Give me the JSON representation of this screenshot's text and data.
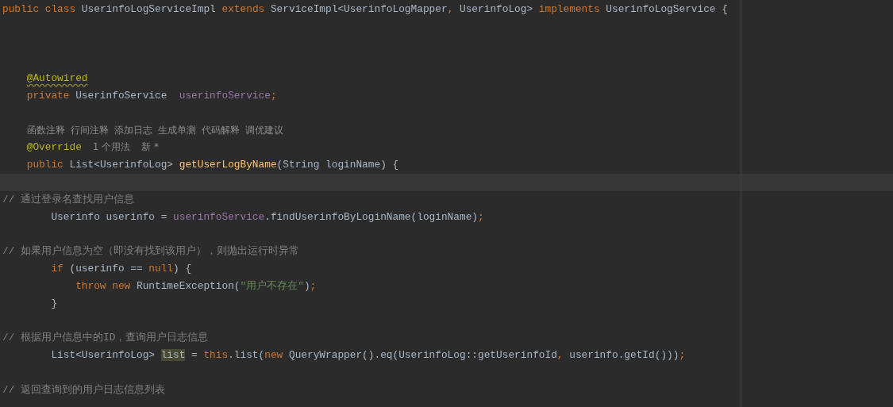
{
  "editor": {
    "lines": [
      {
        "kind": "code",
        "tokens": [
          {
            "text": "public class ",
            "kind": "keyword"
          },
          {
            "text": "UserinfoLogServiceImpl ",
            "kind": "plain"
          },
          {
            "text": "extends ",
            "kind": "keyword"
          },
          {
            "text": "ServiceImpl<UserinfoLogMapper",
            "kind": "plain"
          },
          {
            "text": ", ",
            "kind": "keyword"
          },
          {
            "text": "UserinfoLog> ",
            "kind": "plain"
          },
          {
            "text": "implements ",
            "kind": "keyword"
          },
          {
            "text": "UserinfoLogService {",
            "kind": "plain"
          }
        ]
      },
      {
        "kind": "blank"
      },
      {
        "kind": "blank"
      },
      {
        "kind": "blank"
      },
      {
        "kind": "code",
        "tokens": [
          {
            "text": "    @Autowired",
            "kind": "warning"
          }
        ]
      },
      {
        "kind": "code",
        "tokens": [
          {
            "text": "    private ",
            "kind": "keyword"
          },
          {
            "text": "UserinfoService  ",
            "kind": "plain"
          },
          {
            "text": "userinfoService",
            "kind": "field"
          },
          {
            "text": ";",
            "kind": "keyword"
          }
        ]
      },
      {
        "kind": "blank"
      },
      {
        "kind": "actions",
        "actions": [
          "函数注释",
          "行间注释",
          "添加日志",
          "生成单测",
          "代码解释",
          "调优建议"
        ]
      },
      {
        "kind": "code",
        "tokens": [
          {
            "text": "    @Override",
            "kind": "annotation"
          }
        ],
        "hints": [
          "1 个用法",
          "新 *"
        ]
      },
      {
        "kind": "code",
        "tokens": [
          {
            "text": "    public ",
            "kind": "keyword"
          },
          {
            "text": "List<UserinfoLog> ",
            "kind": "plain"
          },
          {
            "text": "getUserLogByName",
            "kind": "method"
          },
          {
            "text": "(String loginName) {",
            "kind": "plain"
          }
        ]
      },
      {
        "kind": "current"
      },
      {
        "kind": "code",
        "tokens": [
          {
            "text": "// 通过登录名查找用户信息",
            "kind": "comment"
          }
        ]
      },
      {
        "kind": "code",
        "tokens": [
          {
            "text": "        Userinfo userinfo = ",
            "kind": "plain"
          },
          {
            "text": "userinfoService",
            "kind": "field"
          },
          {
            "text": ".findUserinfoByLoginName(loginName)",
            "kind": "plain"
          },
          {
            "text": ";",
            "kind": "keyword"
          }
        ]
      },
      {
        "kind": "blank"
      },
      {
        "kind": "code",
        "tokens": [
          {
            "text": "// 如果用户信息为空（即没有找到该用户），则抛出运行时异常",
            "kind": "comment"
          }
        ]
      },
      {
        "kind": "code",
        "tokens": [
          {
            "text": "        if ",
            "kind": "keyword"
          },
          {
            "text": "(userinfo == ",
            "kind": "plain"
          },
          {
            "text": "null",
            "kind": "keyword"
          },
          {
            "text": ") {",
            "kind": "plain"
          }
        ]
      },
      {
        "kind": "code",
        "tokens": [
          {
            "text": "            throw new ",
            "kind": "keyword"
          },
          {
            "text": "RuntimeException(",
            "kind": "plain"
          },
          {
            "text": "\"用户不存在\"",
            "kind": "string"
          },
          {
            "text": ")",
            "kind": "plain"
          },
          {
            "text": ";",
            "kind": "keyword"
          }
        ]
      },
      {
        "kind": "code",
        "tokens": [
          {
            "text": "        }",
            "kind": "plain"
          }
        ]
      },
      {
        "kind": "blank"
      },
      {
        "kind": "code",
        "tokens": [
          {
            "text": "// 根据用户信息中的ID，查询用户日志信息",
            "kind": "comment"
          }
        ]
      },
      {
        "kind": "code",
        "tokens": [
          {
            "text": "        List<UserinfoLog> ",
            "kind": "plain"
          },
          {
            "text": "list",
            "kind": "usage"
          },
          {
            "text": " = ",
            "kind": "plain"
          },
          {
            "text": "this",
            "kind": "keyword"
          },
          {
            "text": ".list(",
            "kind": "plain"
          },
          {
            "text": "new ",
            "kind": "keyword"
          },
          {
            "text": "QueryWrapper().eq(UserinfoLog::getUserinfoId",
            "kind": "plain"
          },
          {
            "text": ", ",
            "kind": "keyword"
          },
          {
            "text": "userinfo.getId()))",
            "kind": "plain"
          },
          {
            "text": ";",
            "kind": "keyword"
          }
        ]
      },
      {
        "kind": "blank"
      },
      {
        "kind": "code",
        "tokens": [
          {
            "text": "// 返回查询到的用户日志信息列表",
            "kind": "comment"
          }
        ]
      }
    ]
  }
}
